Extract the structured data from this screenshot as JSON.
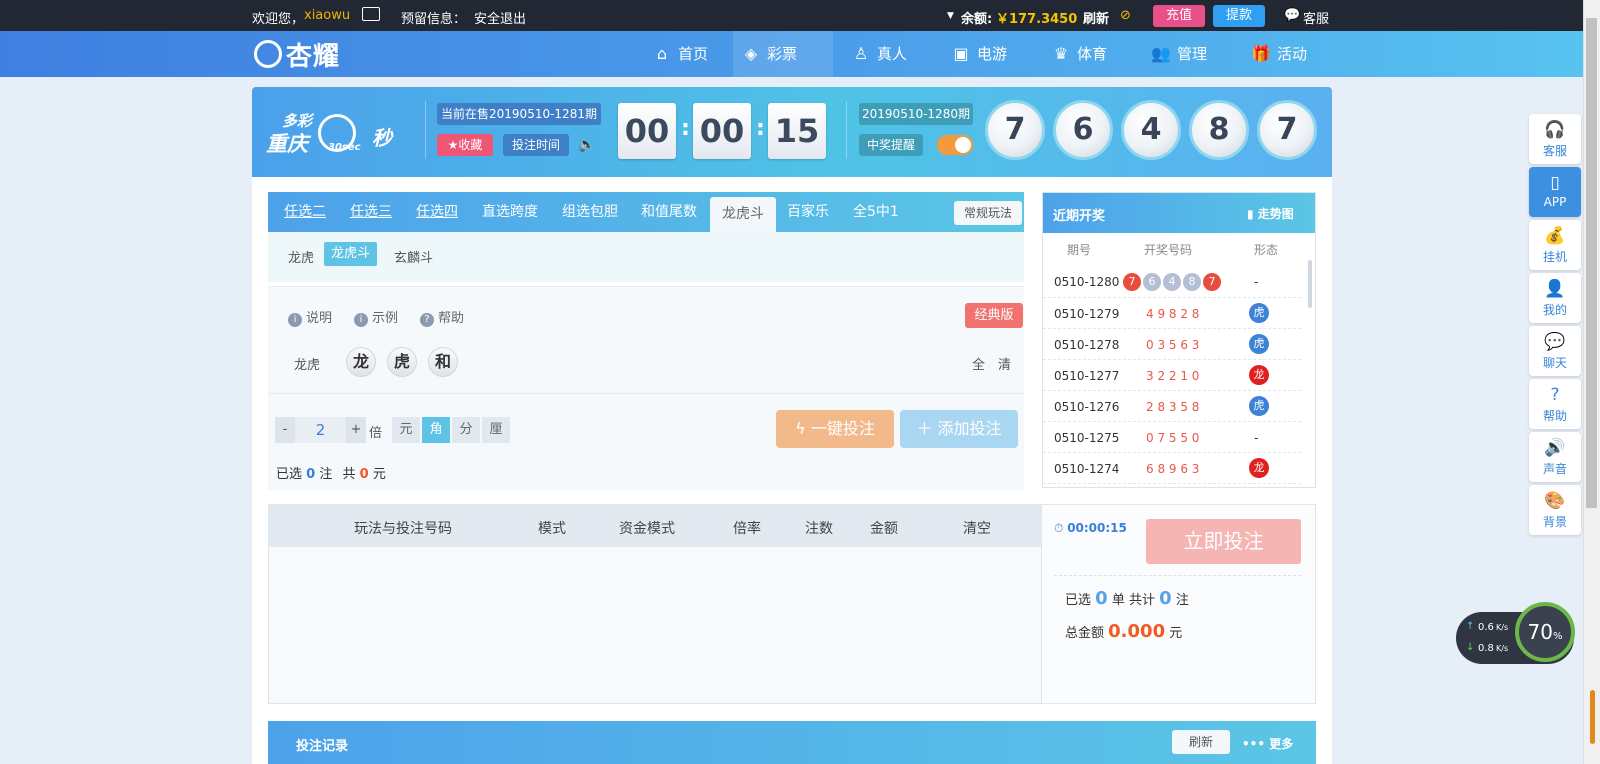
{
  "topbar": {
    "welcome": "欢迎您，",
    "username": "xiaowu",
    "reserved_info_label": "预留信息：",
    "logout": "安全退出",
    "balance_label": "余额:",
    "balance": "￥177.3450",
    "refresh": "刷新",
    "recharge": "充值",
    "withdraw": "提款",
    "service": "客服"
  },
  "nav": {
    "logo": "杏耀",
    "items": [
      {
        "label": "首页",
        "icon": "home-icon"
      },
      {
        "label": "彩票",
        "icon": "ticket-icon"
      },
      {
        "label": "真人",
        "icon": "person-icon"
      },
      {
        "label": "电游",
        "icon": "slot-icon"
      },
      {
        "label": "体育",
        "icon": "trophy-icon"
      },
      {
        "label": "管理",
        "icon": "users-icon"
      },
      {
        "label": "活动",
        "icon": "gift-icon"
      }
    ]
  },
  "game": {
    "logo_top": "多彩",
    "logo_main": "重庆",
    "logo_sec": "30sec",
    "logo_suffix": "秒",
    "current_period": "当前在售20190510-1281期",
    "favorite": "★收藏",
    "bet_time": "投注时间",
    "countdown": [
      "00",
      "00",
      "15"
    ],
    "last_period": "20190510-1280期",
    "win_alert": "中奖提醒",
    "result": [
      "7",
      "6",
      "4",
      "8",
      "7"
    ]
  },
  "tabs": {
    "items": [
      "任选二",
      "任选三",
      "任选四",
      "直选跨度",
      "组选包胆",
      "和值尾数",
      "龙虎斗",
      "百家乐",
      "全5中1"
    ],
    "active": "龙虎斗",
    "mode_button": "常规玩法",
    "subtabs": [
      "龙虎",
      "龙虎斗",
      "玄麟斗"
    ],
    "active_subtab": "龙虎斗"
  },
  "panel": {
    "explain": "说明",
    "example": "示例",
    "help": "帮助",
    "classic": "经典版",
    "row_label": "龙虎",
    "options": [
      "龙",
      "虎",
      "和"
    ],
    "all": "全",
    "clear": "清",
    "multiplier_minus": "-",
    "multiplier": "2",
    "multiplier_plus": "+",
    "multiplier_unit": "倍",
    "units": [
      "元",
      "角",
      "分",
      "厘"
    ],
    "active_unit": "角",
    "quick_bet": "一键投注",
    "add_bet": "添加投注",
    "selected_prefix": "已选",
    "selected_count": "0",
    "selected_unit": "注",
    "total_prefix": "共",
    "total_amount": "0",
    "total_unit": "元"
  },
  "recent": {
    "title": "近期开奖",
    "trend": "走势图",
    "headers": [
      "期号",
      "开奖号码",
      "形态"
    ],
    "rows": [
      {
        "period": "0510-1280",
        "numbers": [
          "7",
          "6",
          "4",
          "8",
          "7"
        ],
        "form": "-"
      },
      {
        "period": "0510-1279",
        "numbers": "4 9 8 2 8",
        "form": "虎"
      },
      {
        "period": "0510-1278",
        "numbers": "0 3 5 6 3",
        "form": "虎"
      },
      {
        "period": "0510-1277",
        "numbers": "3 2 2 1 0",
        "form": "龙"
      },
      {
        "period": "0510-1276",
        "numbers": "2 8 3 5 8",
        "form": "虎"
      },
      {
        "period": "0510-1275",
        "numbers": "0 7 5 5 0",
        "form": "-"
      },
      {
        "period": "0510-1274",
        "numbers": "6 8 9 6 3",
        "form": "龙"
      }
    ]
  },
  "betlist": {
    "headers": [
      "玩法与投注号码",
      "模式",
      "资金模式",
      "倍率",
      "注数",
      "金额",
      "清空"
    ]
  },
  "betside": {
    "timer": "00:00:15",
    "submit": "立即投注",
    "selected_prefix": "已选",
    "selected_orders": "0",
    "orders_unit": "单",
    "total_prefix": "共计",
    "total_bets": "0",
    "bets_unit": "注",
    "amount_label": "总金额",
    "amount": "0.000",
    "amount_unit": "元"
  },
  "records": {
    "title": "投注记录",
    "refresh": "刷新",
    "more": "更多"
  },
  "sidebar": [
    {
      "label": "客服",
      "icon": "headset-icon"
    },
    {
      "label": "APP",
      "icon": "phone-icon"
    },
    {
      "label": "挂机",
      "icon": "money-bag-icon"
    },
    {
      "label": "我的",
      "icon": "user-icon"
    },
    {
      "label": "聊天",
      "icon": "chat-icon"
    },
    {
      "label": "帮助",
      "icon": "help-icon"
    },
    {
      "label": "声音",
      "icon": "speaker-icon"
    },
    {
      "label": "背景",
      "icon": "palette-icon"
    }
  ],
  "netmonitor": {
    "up": "0.6",
    "down": "0.8",
    "rate_unit": "K/s",
    "percent": "70",
    "percent_sign": "%"
  }
}
